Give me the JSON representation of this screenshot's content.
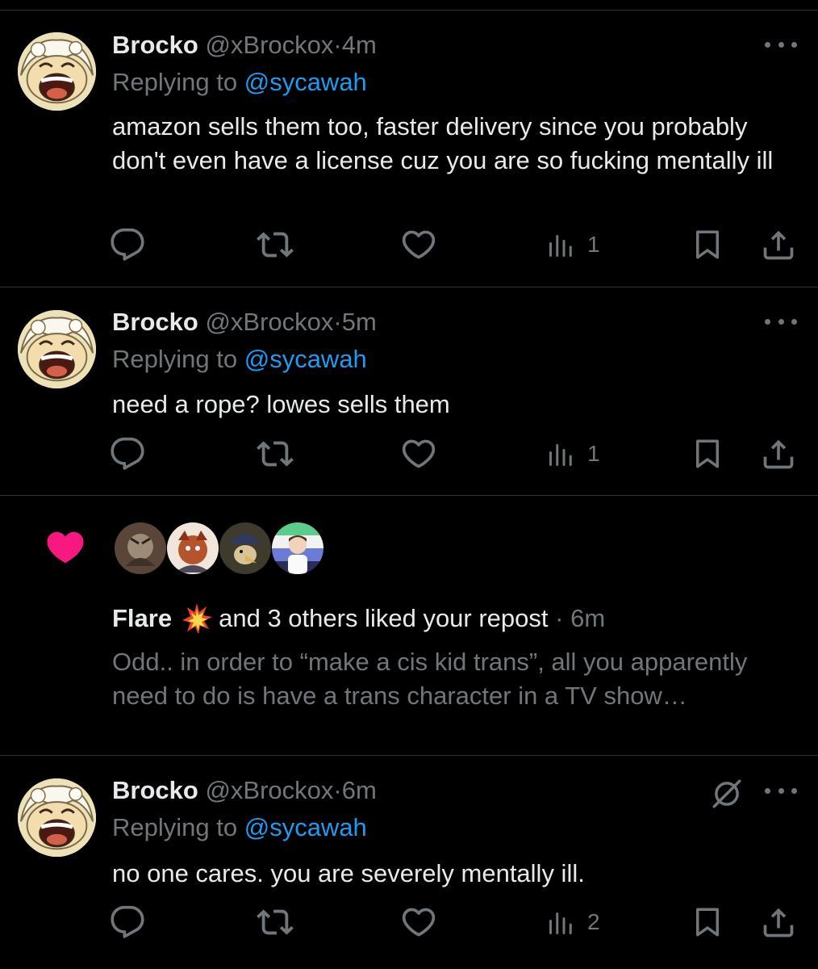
{
  "replies": [
    {
      "author": "Brocko",
      "handle": "@xBrockox",
      "dot": "·",
      "time": "4m",
      "replying_prefix": "Replying to ",
      "replying_to": "@sycawah",
      "text": "amazon sells them too, faster delivery since you probably don't even have a license cuz you are so fucking mentally ill",
      "views": "1",
      "avatar_icon": "anime-avatar"
    },
    {
      "author": "Brocko",
      "handle": "@xBrockox",
      "dot": "·",
      "time": "5m",
      "replying_prefix": "Replying to ",
      "replying_to": "@sycawah",
      "text": "need a rope? lowes sells them",
      "views": "1",
      "avatar_icon": "anime-avatar"
    },
    {
      "author": "Brocko",
      "handle": "@xBrockox",
      "dot": "·",
      "time": "6m",
      "replying_prefix": "Replying to ",
      "replying_to": "@sycawah",
      "text": "no one cares. you are severely mentally ill.",
      "views": "2",
      "avatar_icon": "anime-avatar",
      "extra_icon": "mute-icon"
    }
  ],
  "like_notification": {
    "icon": "heart-icon",
    "icon_color": "#f91880",
    "liker_name": "Flare",
    "emoji": "collision-emoji",
    "action_text": "and 3 others liked your repost",
    "dot": "·",
    "time": "6m",
    "post_preview": "Odd.. in order to “make a cis kid trans”, all you apparently need to do is have a trans character in a TV show…",
    "liker_avatars": [
      "liker-avatar-1",
      "liker-avatar-2",
      "liker-avatar-3",
      "liker-avatar-4"
    ]
  },
  "colors": {
    "background": "#000000",
    "text_primary": "#e7e9ea",
    "text_secondary": "#71767b",
    "link": "#1d9bf0",
    "divider": "#2f3336",
    "like": "#f91880"
  }
}
